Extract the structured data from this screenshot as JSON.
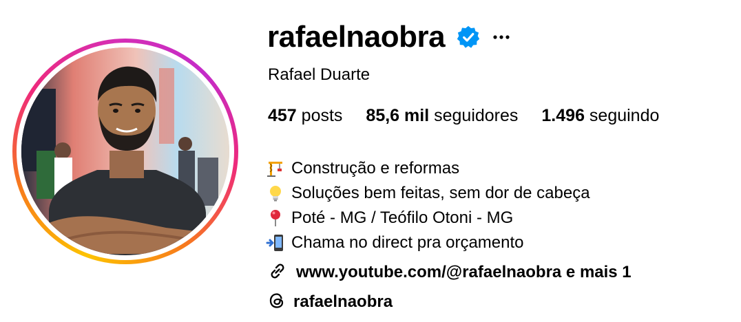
{
  "profile": {
    "username": "rafaelnaobra",
    "full_name": "Rafael Duarte",
    "verified_icon": "verified-badge-icon",
    "more_icon": "more-options-icon",
    "verified_color": "#0095f6",
    "ring_colors": [
      "#fdc300",
      "#f77b1c",
      "#ee2a7b",
      "#c42bc9"
    ]
  },
  "stats": {
    "posts_count": "457",
    "posts_label": " posts",
    "followers_count": "85,6 mil",
    "followers_label": " seguidores",
    "following_count": "1.496",
    "following_label": " seguindo"
  },
  "bio": {
    "lines": [
      {
        "icon": "construction-crane-icon",
        "text": "Construção e reformas"
      },
      {
        "icon": "light-bulb-icon",
        "text": "Soluções bem feitas, sem dor de cabeça"
      },
      {
        "icon": "round-pushpin-icon",
        "text": "Poté - MG / Teófilo Otoni - MG"
      },
      {
        "icon": "mobile-phone-arrow-icon",
        "text": "Chama no direct pra orçamento"
      }
    ]
  },
  "links": {
    "link_icon": "link-icon",
    "link_text": "www.youtube.com/@rafaelnaobra e mais 1",
    "threads_icon": "threads-icon",
    "threads_text": "rafaelnaobra"
  }
}
